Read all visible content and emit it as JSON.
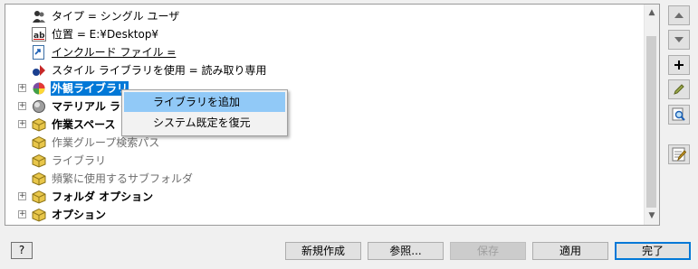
{
  "tree": {
    "rows": [
      {
        "label": "タイプ = シングル ユーザ",
        "icon": "user-icon",
        "style": "normal",
        "expander": false
      },
      {
        "label": "位置 = E:¥Desktop¥",
        "icon": "text-ab-icon",
        "style": "normal",
        "expander": false
      },
      {
        "label": "インクルード ファイル =",
        "icon": "include-file-icon",
        "style": "link",
        "expander": false
      },
      {
        "label": "スタイル ライブラリを使用 = 読み取り専用",
        "icon": "style-library-icon",
        "style": "normal",
        "expander": false
      },
      {
        "label": "外観ライブラリ",
        "icon": "appearance-library-icon",
        "style": "selected",
        "expander": true
      },
      {
        "label": "マテリアル ライ",
        "icon": "material-library-icon",
        "style": "bold",
        "expander": true
      },
      {
        "label": "作業スペース",
        "icon": "folder-icon",
        "style": "bold",
        "expander": true
      },
      {
        "label": "作業グループ検索パス",
        "icon": "folder-icon",
        "style": "dim",
        "expander": false
      },
      {
        "label": "ライブラリ",
        "icon": "folder-icon",
        "style": "dim",
        "expander": false
      },
      {
        "label": "頻繁に使用するサブフォルダ",
        "icon": "folder-icon",
        "style": "dim",
        "expander": false
      },
      {
        "label": "フォルダ オプション",
        "icon": "folder-icon",
        "style": "bold",
        "expander": true
      },
      {
        "label": "オプション",
        "icon": "folder-icon",
        "style": "bold",
        "expander": true
      }
    ]
  },
  "context_menu": {
    "items": [
      {
        "label": "ライブラリを追加",
        "highlighted": true
      },
      {
        "label": "システム既定を復元",
        "highlighted": false
      }
    ]
  },
  "side_buttons": [
    "move-up-icon",
    "move-down-icon",
    "add-icon",
    "edit-pencil-icon",
    "browse-icon",
    "edit-settings-icon"
  ],
  "buttons": {
    "help": "?",
    "new": "新規作成",
    "browse": "参照...",
    "save": "保存",
    "apply": "適用",
    "done": "完了"
  },
  "colors": {
    "selection": "#0078d7",
    "menu_highlight": "#91c9f7",
    "folder": "#e8c64a"
  }
}
